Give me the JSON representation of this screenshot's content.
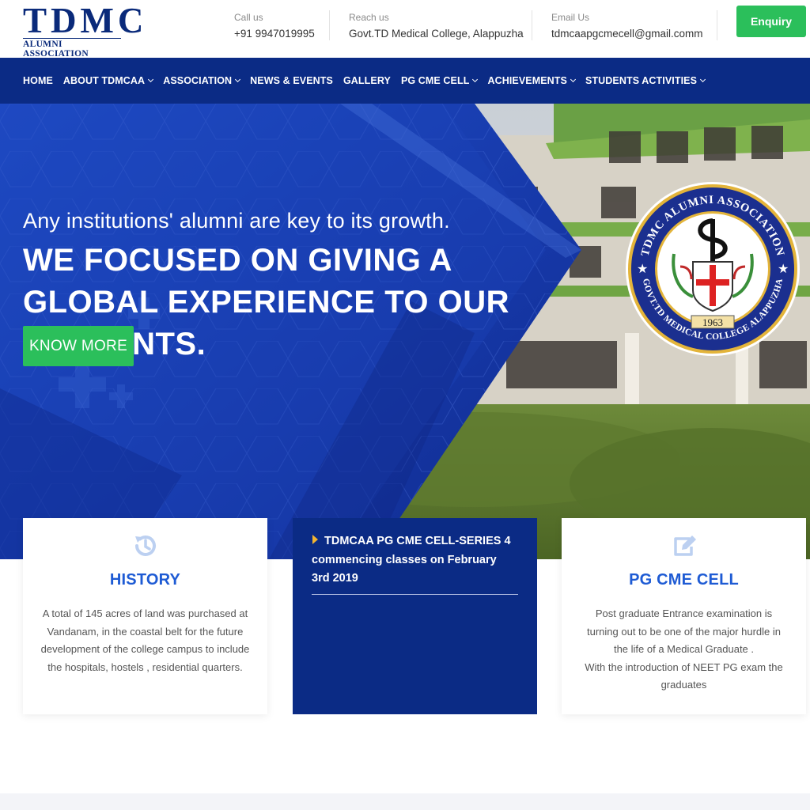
{
  "brand": {
    "logo_main": "TDMC",
    "logo_sub": "ALUMNI ASSOCIATION"
  },
  "contacts": [
    {
      "label": "Call us",
      "value": "+91 9947019995"
    },
    {
      "label": "Reach us",
      "value": "Govt.TD Medical College, Alappuzha"
    },
    {
      "label": "Email Us",
      "value": "tdmcaapgcmecell@gmail.comm"
    }
  ],
  "enquiry_label": "Enquiry",
  "nav": {
    "items": [
      {
        "label": "HOME",
        "dropdown": false
      },
      {
        "label": "ABOUT TDMCAA",
        "dropdown": true
      },
      {
        "label": "ASSOCIATION",
        "dropdown": true
      },
      {
        "label": "NEWS & EVENTS",
        "dropdown": false
      },
      {
        "label": "GALLERY",
        "dropdown": false
      },
      {
        "label": "PG CME CELL",
        "dropdown": true
      },
      {
        "label": "ACHIEVEMENTS",
        "dropdown": true
      },
      {
        "label": "STUDENTS ACTIVITIES",
        "dropdown": true
      }
    ]
  },
  "hero": {
    "subtitle": "Any institutions' alumni are key to its growth.",
    "title": "WE FOCUSED ON GIVING A GLOBAL EXPERIENCE TO OUR STUDENTS.",
    "button_label": "KNOW MORE",
    "emblem": {
      "ring_text_top": "TDMC ALUMNI ASSOCIATION",
      "ring_text_bottom": "GOVT.TD MEDICAL COLLEGE ALAPPUZHA",
      "year": "1963"
    }
  },
  "cards": {
    "history": {
      "icon": "history-icon",
      "title": "HISTORY",
      "text": "A total of 145 acres of land was purchased at Vandanam, in the coastal belt for the future development of the college campus to include the hospitals, hostels , residential quarters."
    },
    "news": {
      "text": "TDMCAA PG CME CELL-SERIES 4 commencing classes on February 3rd 2019"
    },
    "pgcme": {
      "icon": "edit-icon",
      "title": "PG CME CELL",
      "text_line1": "Post graduate Entrance examination is turning out to be one of the major hurdle in the life of a Medical Graduate .",
      "text_line2": "With the introduction of NEET PG exam the graduates"
    }
  },
  "colors": {
    "navy": "#0b2b85",
    "blue_accent": "#1e5bd4",
    "green": "#2bbf5b",
    "gold": "#f2b531"
  }
}
